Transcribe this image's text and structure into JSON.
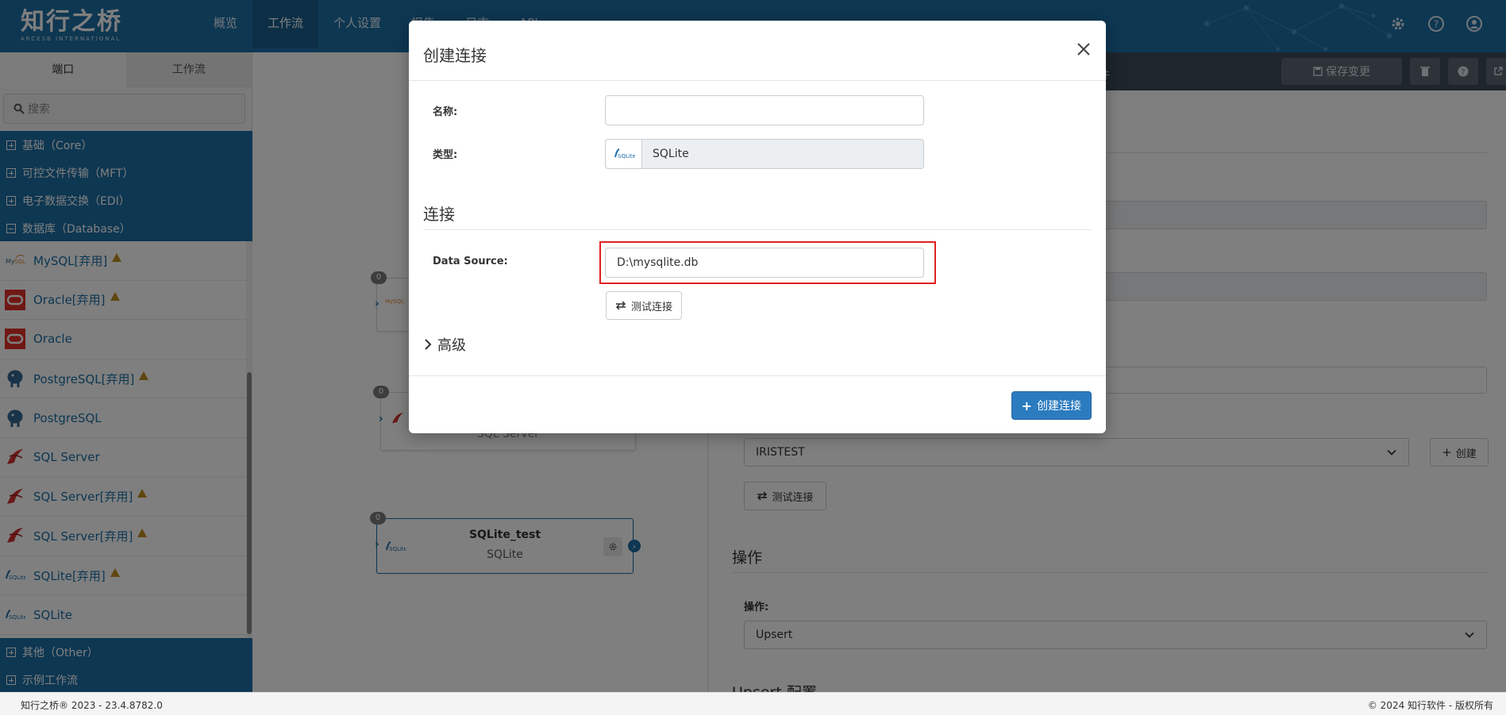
{
  "header": {
    "logo_cn": "知行之桥",
    "logo_en": "ARCESB INTERNATIONAL",
    "nav": [
      "概览",
      "工作流",
      "个人设置",
      "报告",
      "日志",
      "API"
    ],
    "active_nav": "工作流"
  },
  "sidebar": {
    "tabs": [
      "端口",
      "工作流"
    ],
    "search_placeholder": "搜索",
    "categories_top": [
      "基础（Core）",
      "可控文件传输（MFT）",
      "电子数据交换（EDI）",
      "数据库（Database）"
    ],
    "db_items": [
      {
        "label": "MySQL[弃用]",
        "warn": true,
        "icon": "mysql-icon"
      },
      {
        "label": "Oracle[弃用]",
        "warn": true,
        "icon": "oracle-icon"
      },
      {
        "label": "Oracle",
        "warn": false,
        "icon": "oracle-icon"
      },
      {
        "label": "PostgreSQL[弃用]",
        "warn": true,
        "icon": "postgresql-icon"
      },
      {
        "label": "PostgreSQL",
        "warn": false,
        "icon": "postgresql-icon"
      },
      {
        "label": "SQL Server",
        "warn": false,
        "icon": "sqlserver-icon"
      },
      {
        "label": "SQL Server[弃用]",
        "warn": true,
        "icon": "sqlserver-icon"
      },
      {
        "label": "SQL Server[弃用]",
        "warn": true,
        "icon": "sqlserver-icon"
      },
      {
        "label": "SQLite[弃用]",
        "warn": true,
        "icon": "sqlite-icon"
      },
      {
        "label": "SQLite",
        "warn": false,
        "icon": "sqlite-icon"
      }
    ],
    "categories_bottom": [
      "其他（Other）",
      "示例工作流"
    ]
  },
  "canvas": {
    "nodes": [
      {
        "badge": "0",
        "title": "",
        "subtitle": ""
      },
      {
        "badge": "0",
        "title": "",
        "subtitle": "SQL Server"
      },
      {
        "badge": "0",
        "title": "SQLite_test",
        "subtitle": "SQLite"
      }
    ]
  },
  "right_panel": {
    "tab_events": "事件",
    "save_label": "保存变更",
    "connection_value": "IRISTEST",
    "create_label": "创建",
    "test_conn_label": "测试连接",
    "operation_heading": "操作",
    "operation_label": "操作:",
    "operation_value": "Upsert",
    "upsert_heading": "Upsert 配置"
  },
  "modal": {
    "title": "创建连接",
    "name_label": "名称:",
    "name_value": "",
    "type_label": "类型:",
    "type_value": "SQLite",
    "section_connection": "连接",
    "datasource_label": "Data Source:",
    "datasource_value": "D:\\mysqlite.db",
    "test_button": "测试连接",
    "advanced_label": "高级",
    "create_button": "创建连接"
  },
  "footer": {
    "left": "知行之桥® 2023 - 23.4.8782.0",
    "right": "© 2024 知行软件 - 版权所有"
  }
}
